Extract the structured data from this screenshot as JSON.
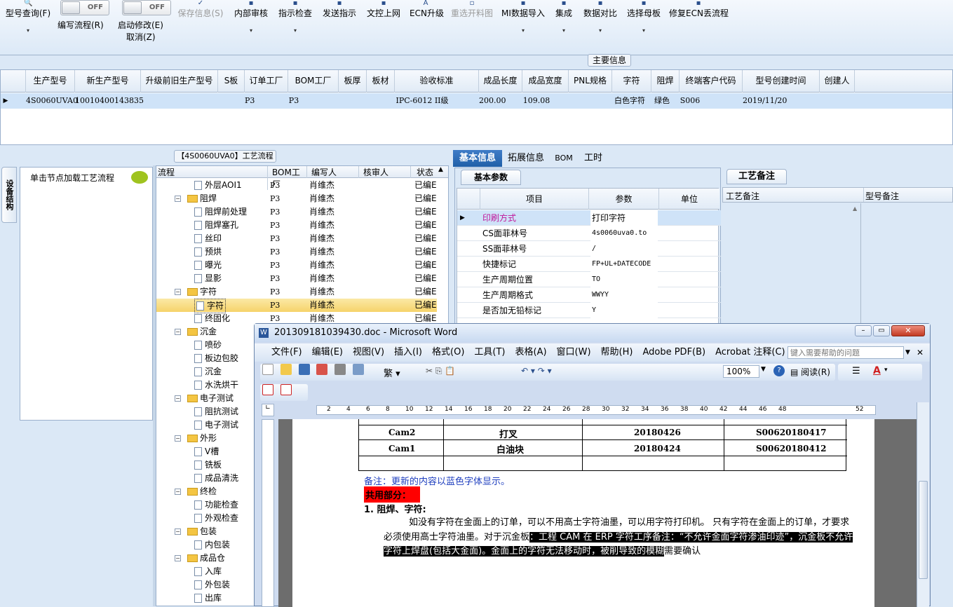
{
  "toolbar": {
    "items": [
      {
        "label": "型号查询(F)",
        "disabled": false,
        "dropdown": true
      },
      {
        "label": "保存信息(S)",
        "disabled": true,
        "dropdown": false
      },
      {
        "label": "内部审核",
        "disabled": false,
        "dropdown": true
      },
      {
        "label": "指示检查",
        "disabled": false,
        "dropdown": true
      },
      {
        "label": "发送指示",
        "disabled": false,
        "dropdown": false
      },
      {
        "label": "文控上网",
        "disabled": false,
        "dropdown": false
      },
      {
        "label": "ECN升级",
        "disabled": false,
        "dropdown": false
      },
      {
        "label": "重选开料图",
        "disabled": true,
        "dropdown": false
      },
      {
        "label": "MI数据导入",
        "disabled": false,
        "dropdown": true
      },
      {
        "label": "集成",
        "disabled": false,
        "dropdown": true
      },
      {
        "label": "数据对比",
        "disabled": false,
        "dropdown": true
      },
      {
        "label": "选择母板",
        "disabled": false,
        "dropdown": true
      },
      {
        "label": "修复ECN丢流程",
        "disabled": false,
        "dropdown": false
      }
    ],
    "toggle1": {
      "state": "OFF",
      "label": "编写流程(R)"
    },
    "toggle2": {
      "state": "OFF",
      "label": "启动修改(E)",
      "sub": "取消(Z)"
    }
  },
  "main_info": {
    "title": "主要信息",
    "columns": [
      "生产型号",
      "新生产型号",
      "升级前旧生产型号",
      "S板",
      "订单工厂",
      "BOM工厂",
      "板厚",
      "板材",
      "验收标准",
      "成品长度",
      "成品宽度",
      "PNL规格",
      "字符",
      "阻焊",
      "终端客户代码",
      "型号创建时间",
      "创建人"
    ],
    "row": [
      "4S0060UVA0",
      "10010400143835",
      "",
      "",
      "P3",
      "P3",
      "",
      "",
      "IPC-6012 II级",
      "200.00",
      "109.08",
      "",
      "白色字符",
      "绿色",
      "S006",
      "2019/11/20",
      ""
    ]
  },
  "left_tab": "设备结构",
  "node_hint": "单击节点加载工艺流程",
  "flow": {
    "title": "【4S0060UVA0】工艺流程",
    "columns": [
      "流程",
      "BOM工厂",
      "编写人",
      "核审人",
      "状态"
    ],
    "rows": [
      {
        "name": "外层AOI1",
        "level": 1,
        "folder": false,
        "bom": "P3",
        "author": "肖维杰",
        "status": "已编E"
      },
      {
        "name": "阻焊",
        "level": 0,
        "folder": true,
        "bom": "P3",
        "author": "肖维杰",
        "status": "已编E"
      },
      {
        "name": "阻焊前处理",
        "level": 1,
        "folder": false,
        "bom": "P3",
        "author": "肖维杰",
        "status": "已编E"
      },
      {
        "name": "阻焊塞孔",
        "level": 1,
        "folder": false,
        "bom": "P3",
        "author": "肖维杰",
        "status": "已编E"
      },
      {
        "name": "丝印",
        "level": 1,
        "folder": false,
        "bom": "P3",
        "author": "肖维杰",
        "status": "已编E"
      },
      {
        "name": "预烘",
        "level": 1,
        "folder": false,
        "bom": "P3",
        "author": "肖维杰",
        "status": "已编E"
      },
      {
        "name": "曝光",
        "level": 1,
        "folder": false,
        "bom": "P3",
        "author": "肖维杰",
        "status": "已编E"
      },
      {
        "name": "显影",
        "level": 1,
        "folder": false,
        "bom": "P3",
        "author": "肖维杰",
        "status": "已编E"
      },
      {
        "name": "字符",
        "level": 0,
        "folder": true,
        "bom": "P3",
        "author": "肖维杰",
        "status": "已编E"
      },
      {
        "name": "字符",
        "level": 1,
        "folder": false,
        "bom": "P3",
        "author": "肖维杰",
        "status": "已编E",
        "selected": true
      },
      {
        "name": "终固化",
        "level": 1,
        "folder": false,
        "bom": "P3",
        "author": "肖维杰",
        "status": "已编E"
      },
      {
        "name": "沉金",
        "level": 0,
        "folder": true
      },
      {
        "name": "喷砂",
        "level": 1,
        "folder": false
      },
      {
        "name": "板边包胶",
        "level": 1,
        "folder": false
      },
      {
        "name": "沉金",
        "level": 1,
        "folder": false
      },
      {
        "name": "水洗烘干",
        "level": 1,
        "folder": false
      },
      {
        "name": "电子测试",
        "level": 0,
        "folder": true
      },
      {
        "name": "阻抗测试",
        "level": 1,
        "folder": false
      },
      {
        "name": "电子测试",
        "level": 1,
        "folder": false
      },
      {
        "name": "外形",
        "level": 0,
        "folder": true
      },
      {
        "name": "V槽",
        "level": 1,
        "folder": false
      },
      {
        "name": "铣板",
        "level": 1,
        "folder": false
      },
      {
        "name": "成品清洗",
        "level": 1,
        "folder": false
      },
      {
        "name": "终检",
        "level": 0,
        "folder": true
      },
      {
        "name": "功能检查",
        "level": 1,
        "folder": false
      },
      {
        "name": "外观检查",
        "level": 1,
        "folder": false
      },
      {
        "name": "包装",
        "level": 0,
        "folder": true
      },
      {
        "name": "内包装",
        "level": 1,
        "folder": false
      },
      {
        "name": "成品仓",
        "level": 0,
        "folder": true
      },
      {
        "name": "入库",
        "level": 1,
        "folder": false
      },
      {
        "name": "外包装",
        "level": 1,
        "folder": false
      },
      {
        "name": "出库",
        "level": 1,
        "folder": false
      }
    ]
  },
  "right_tabs": [
    "基本信息",
    "拓展信息",
    "BOM",
    "工时"
  ],
  "basic": {
    "title": "基本参数",
    "columns": [
      "项目",
      "参数",
      "单位"
    ],
    "rows": [
      {
        "item": "印刷方式",
        "value": "打印字符"
      },
      {
        "item": "CS面菲林号",
        "value": "4s0060uva0.to"
      },
      {
        "item": "SS面菲林号",
        "value": "/"
      },
      {
        "item": "快捷标记",
        "value": "FP+UL+DATECODE"
      },
      {
        "item": "生产周期位置",
        "value": "TO"
      },
      {
        "item": "生产周期格式",
        "value": "WWYY"
      },
      {
        "item": "是否加无铅标记",
        "value": "Y"
      }
    ]
  },
  "notes": {
    "title": "工艺备注",
    "col1": "工艺备注",
    "col2": "型号备注"
  },
  "word": {
    "title": "201309181039430.doc - Microsoft Word",
    "menus": [
      "文件(F)",
      "编辑(E)",
      "视图(V)",
      "插入(I)",
      "格式(O)",
      "工具(T)",
      "表格(A)",
      "窗口(W)",
      "帮助(H)",
      "Adobe PDF(B)",
      "Acrobat 注释(C)"
    ],
    "help_placeholder": "键入需要帮助的问题",
    "zoom": "100%",
    "read_label": "阅读(R)",
    "ruler": [
      "2",
      "4",
      "6",
      "8",
      "10",
      "12",
      "14",
      "16",
      "18",
      "20",
      "22",
      "24",
      "26",
      "28",
      "30",
      "32",
      "34",
      "36",
      "38",
      "40",
      "42",
      "44",
      "46",
      "48",
      "52"
    ],
    "table_rows": [
      [
        "Cam2",
        "打叉",
        "20180426",
        "S00620180417"
      ],
      [
        "Cam1",
        "白油块",
        "20180424",
        "S00620180412"
      ]
    ],
    "note": "备注：更新的内容以蓝色字体显示。",
    "section": "共用部分：",
    "heading": "1.   阻焊、字符:",
    "para1": "如没有字符在金面上的订单，可以不用高士字符油墨，可以用字符打印机。   只有字符在金面上的订单，才要求必须使用高士字符油墨。对于沉金板",
    "para_hl": "：工程 CAM 在 ERP 字符工序备注：“不允许金面字符渗油印迹”，沉金板不允许字符上焊盘(包括大金面)。金面上的字符无法移动时，被削导致的模糊",
    "para_end": "需要确认"
  },
  "colors": {
    "accent": "#1f5fa8",
    "selected_row": "#f6d36a",
    "highlight_red": "#ff0000"
  }
}
